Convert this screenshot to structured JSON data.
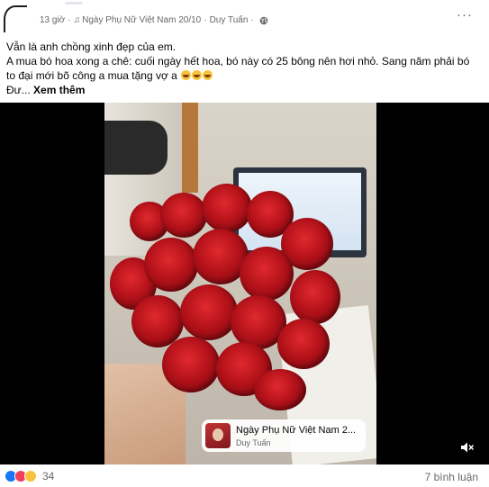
{
  "post": {
    "time": "13 giờ",
    "music_label": "Ngày Phụ Nữ Việt Nam 20/10",
    "dot": "·",
    "artist": "Duy Tuấn",
    "visibility_icon": "globe-icon",
    "more_label": "···"
  },
  "caption": {
    "line1": "Vẫn là anh chồng xinh đẹp của em.",
    "line2": "A mua bó hoa xong a chê: cuối ngày hết hoa, bó này có 25 bông nên hơi nhỏ. Sang năm phải bó",
    "line3": "to đại mới bõ công a mua tặng vợ a",
    "line4_prefix": "Đư...",
    "see_more": "Xem thêm"
  },
  "audio_card": {
    "title": "Ngày Phụ Nữ Việt Nam 2...",
    "artist": "Duy Tuấn"
  },
  "footer": {
    "reaction_count": "34",
    "comment_count": "7 bình luận",
    "reaction_icons": [
      "like-icon",
      "love-icon",
      "haha-icon"
    ]
  },
  "colors": {
    "meta_text": "#65676b",
    "like_blue": "#1877f2",
    "love_red": "#f33e58",
    "haha_yellow": "#f7c33a"
  }
}
